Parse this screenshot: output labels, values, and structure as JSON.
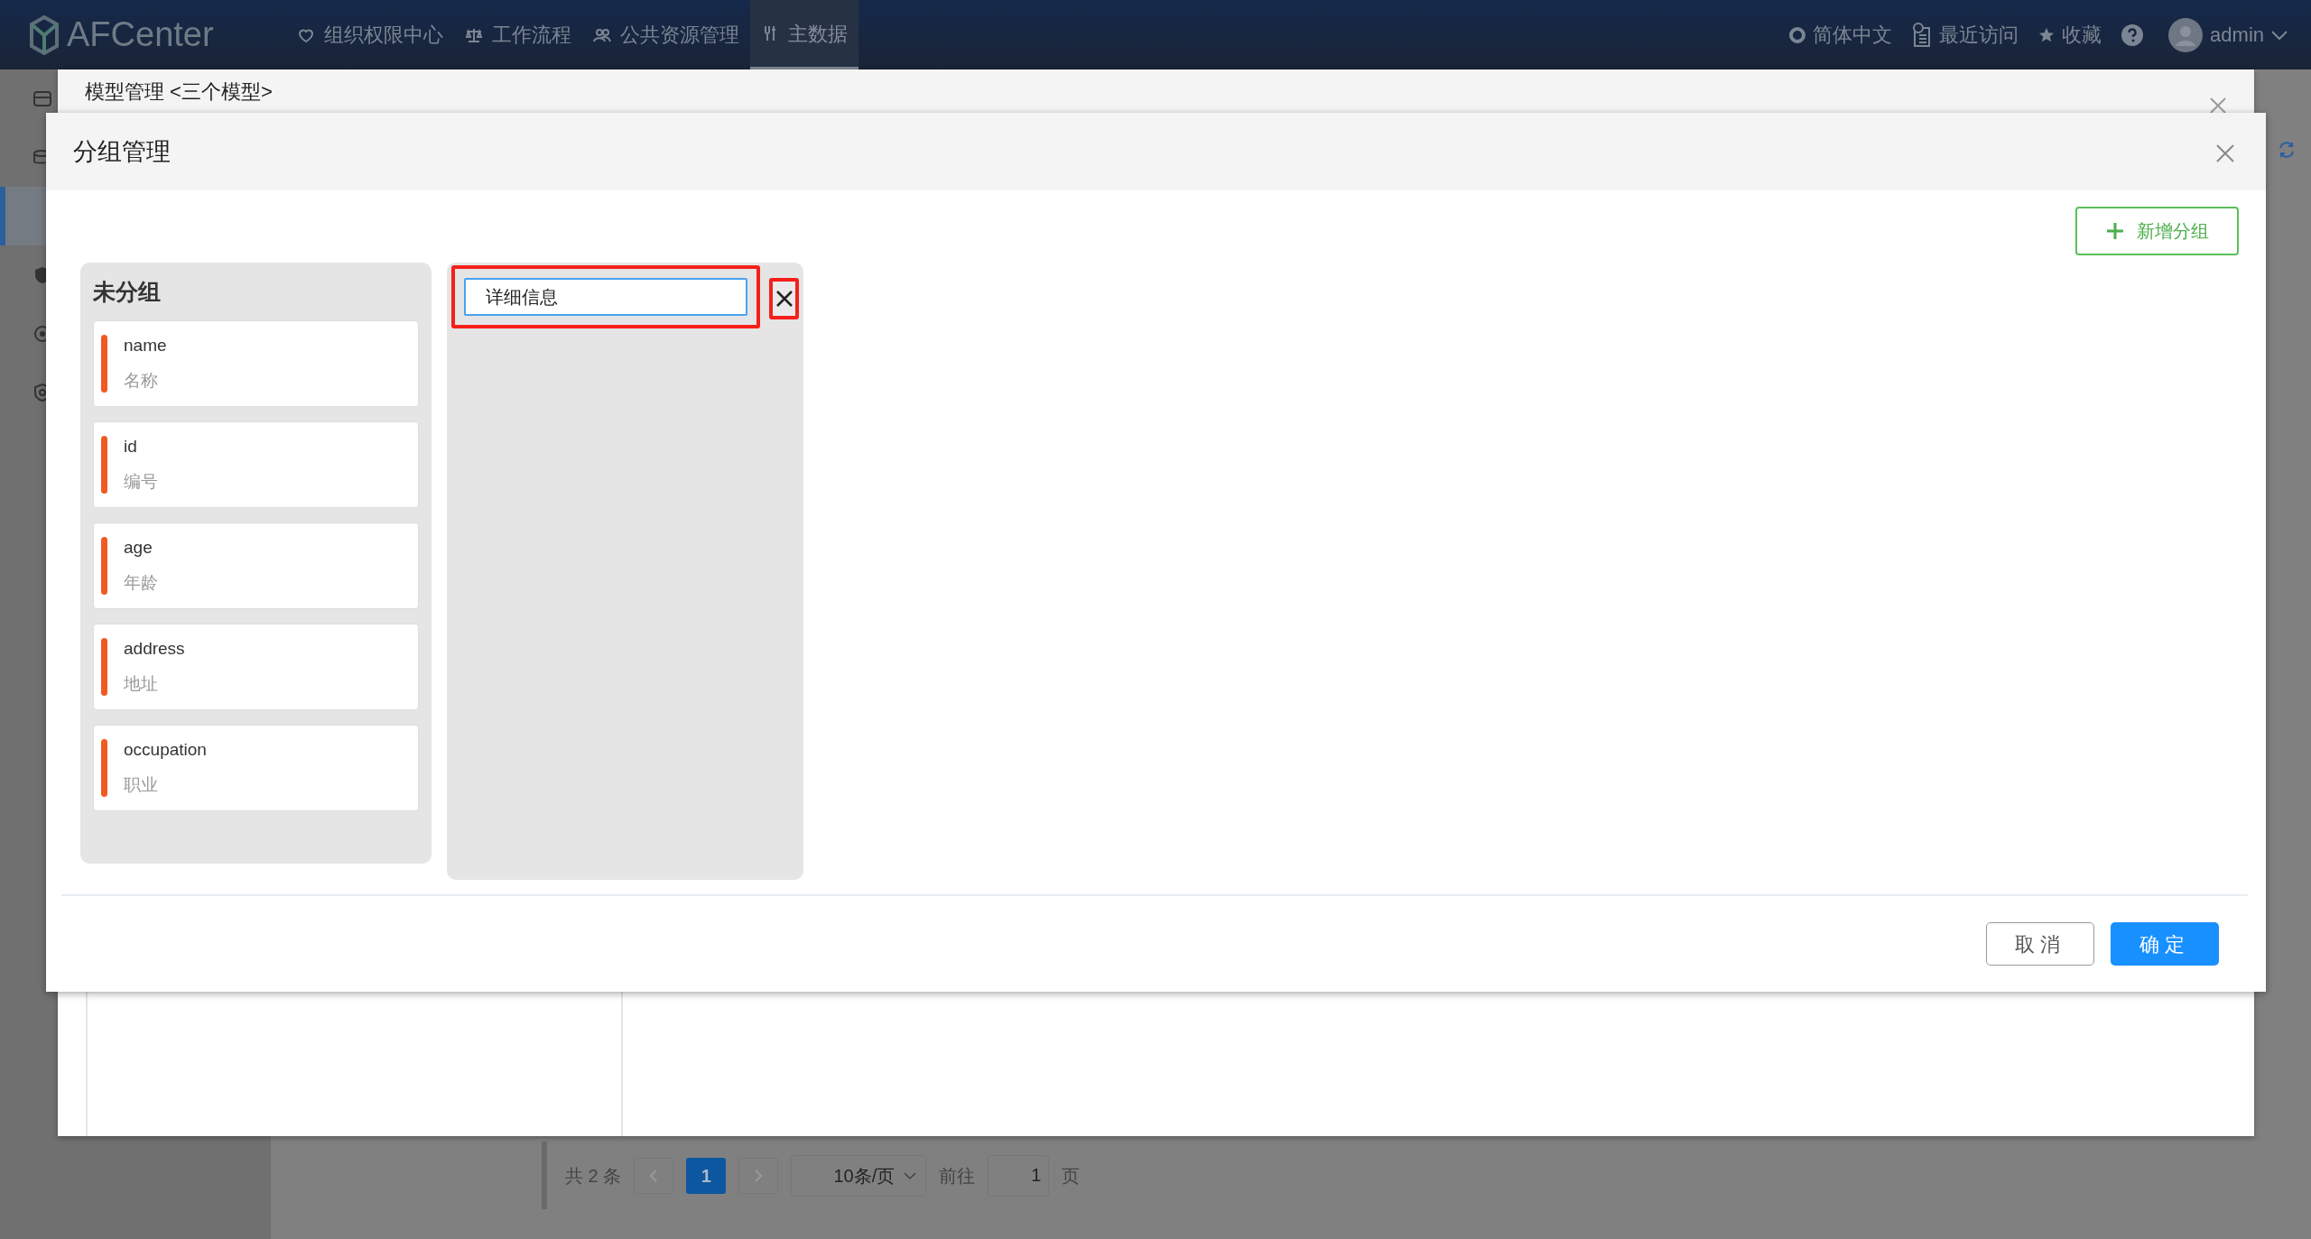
{
  "navbar": {
    "logo": "AFCenter",
    "menu": [
      {
        "label": "组织权限中心",
        "selected": false
      },
      {
        "label": "工作流程",
        "selected": false
      },
      {
        "label": "公共资源管理",
        "selected": false
      },
      {
        "label": "主数据",
        "selected": true
      }
    ],
    "language": "简体中文",
    "recent": "最近访问",
    "favorites": "收藏",
    "user": "admin"
  },
  "sidebar": {
    "items": [
      {
        "selected": false
      },
      {
        "selected": false
      },
      {
        "selected": true
      },
      {
        "selected": false
      },
      {
        "selected": false
      },
      {
        "selected": false
      }
    ]
  },
  "background_modal": {
    "title": "模型管理 <三个模型>"
  },
  "pagination": {
    "total": "共 2 条",
    "pages": [
      {
        "label": "1",
        "selected": true
      }
    ],
    "page_size": "10条/页",
    "goto_label": "前往",
    "goto_value": "1",
    "page_suffix": "页"
  },
  "dialog": {
    "title": "分组管理",
    "add_button": "新增分组",
    "groups": [
      {
        "kind": "list",
        "title": "未分组",
        "fields": [
          {
            "name": "name",
            "label": "名称"
          },
          {
            "name": "id",
            "label": "编号"
          },
          {
            "name": "age",
            "label": "年龄"
          },
          {
            "name": "address",
            "label": "地址"
          },
          {
            "name": "occupation",
            "label": "职业"
          }
        ]
      },
      {
        "kind": "editing",
        "name_value": "详细信息"
      }
    ],
    "buttons": [
      {
        "label": "取消",
        "primary": false
      },
      {
        "label": "确定",
        "primary": true
      }
    ]
  }
}
